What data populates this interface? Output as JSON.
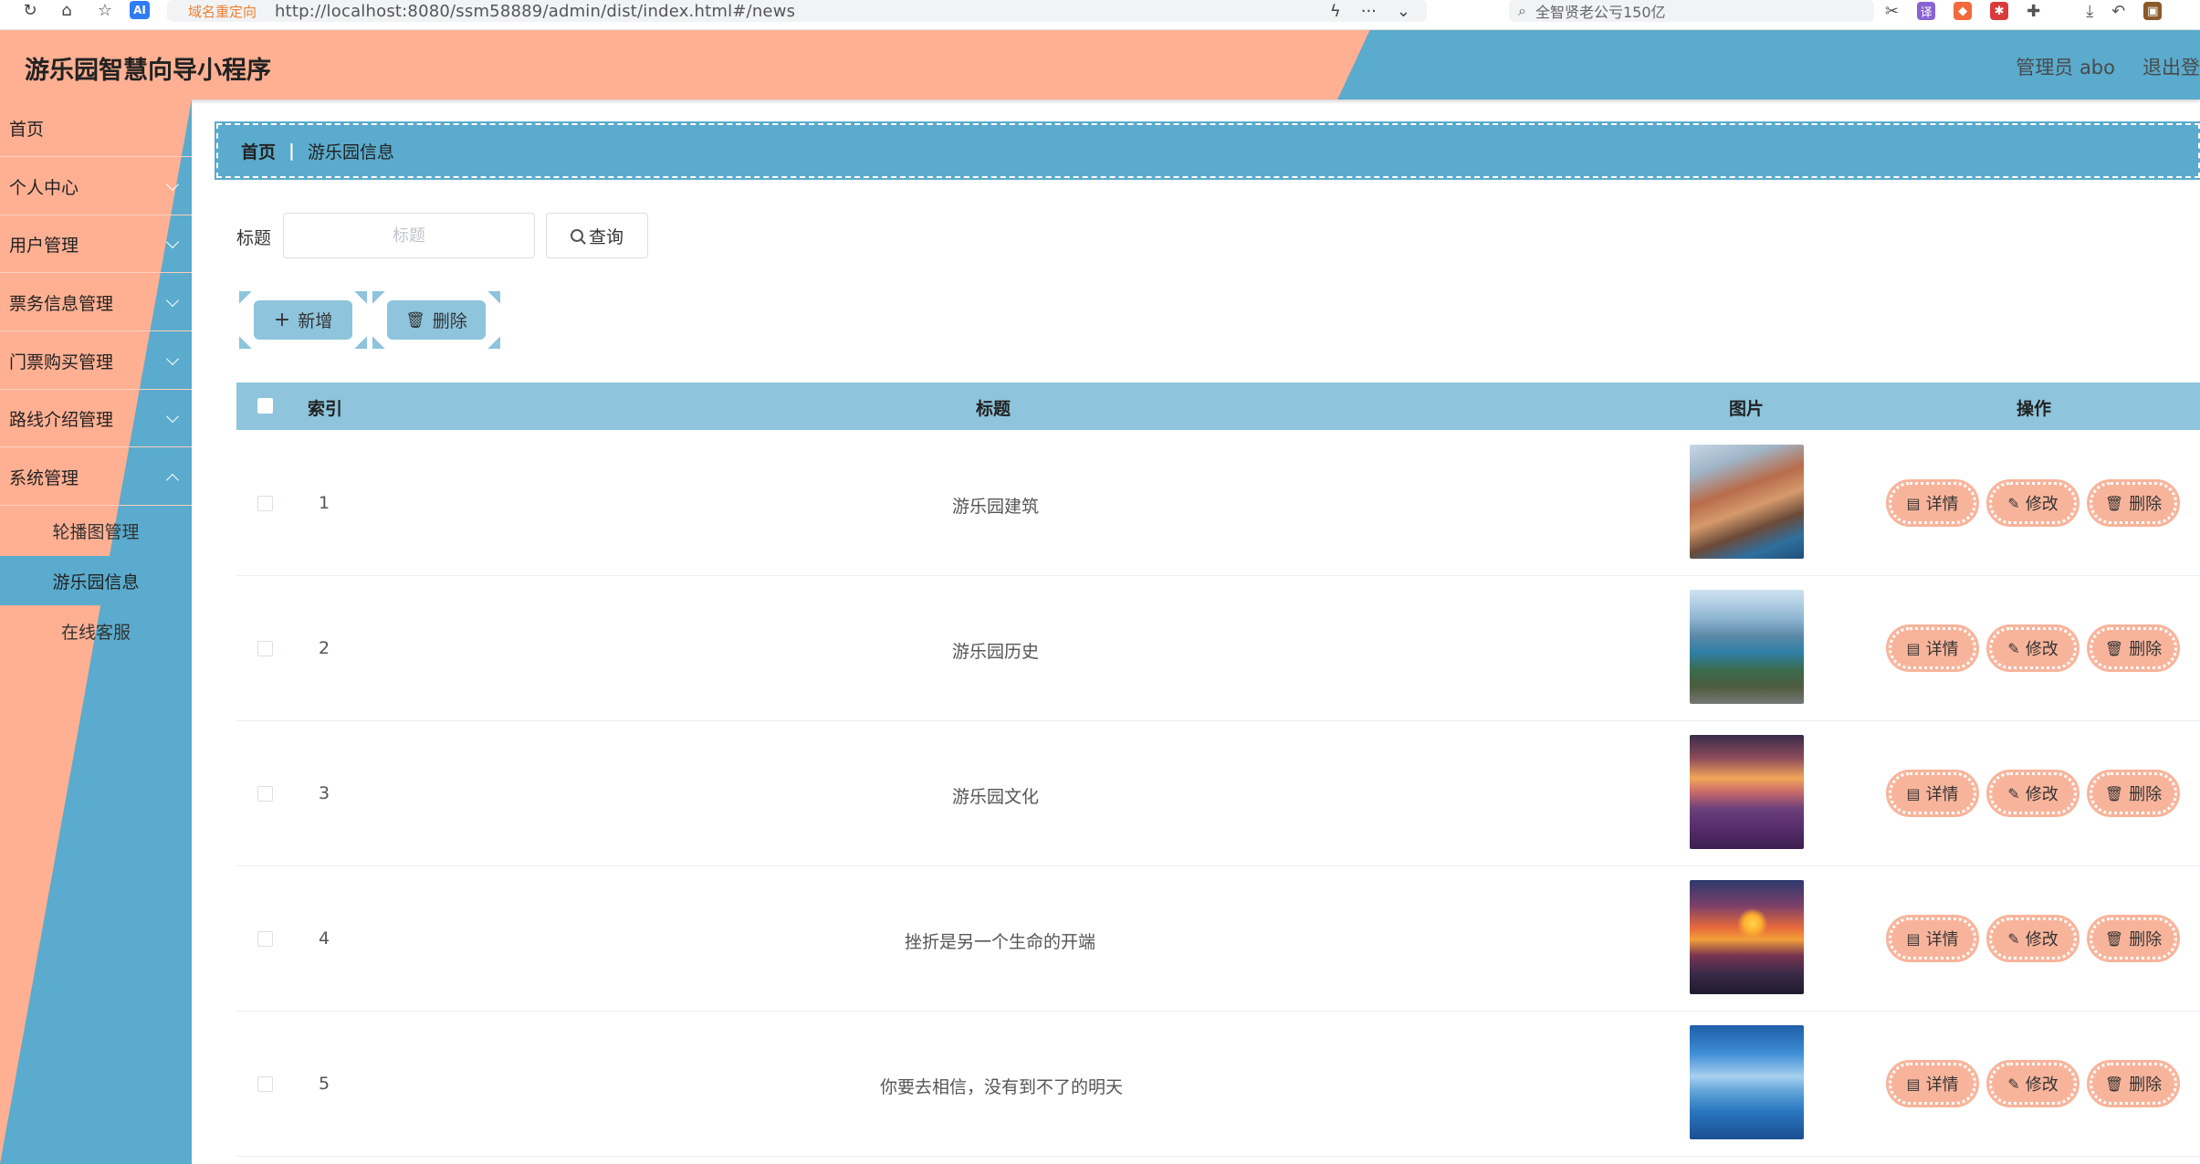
{
  "browser": {
    "url_tag": "域名重定向",
    "url": "http://localhost:8080/ssm58889/admin/dist/index.html#/news",
    "search_text": "全智贤老公亏150亿",
    "ai_label": "AI"
  },
  "header": {
    "title": "游乐园智慧向导小程序",
    "user": "管理员 abo",
    "logout": "退出登"
  },
  "sidebar": {
    "items": [
      {
        "label": "首页"
      },
      {
        "label": "个人中心"
      },
      {
        "label": "用户管理"
      },
      {
        "label": "票务信息管理"
      },
      {
        "label": "门票购买管理"
      },
      {
        "label": "路线介绍管理"
      },
      {
        "label": "系统管理"
      }
    ],
    "sub_items": [
      {
        "label": "轮播图管理"
      },
      {
        "label": "游乐园信息"
      },
      {
        "label": "在线客服"
      }
    ]
  },
  "breadcrumb": {
    "home": "首页",
    "separator": "|",
    "current": "游乐园信息"
  },
  "search": {
    "label": "标题",
    "placeholder": "标题",
    "button": "查询"
  },
  "actions": {
    "add": "新增",
    "delete": "删除"
  },
  "table": {
    "columns": {
      "index": "索引",
      "title": "标题",
      "image": "图片",
      "ops": "操作"
    },
    "rows": [
      {
        "index": "1",
        "title": "游乐园建筑"
      },
      {
        "index": "2",
        "title": "游乐园历史"
      },
      {
        "index": "3",
        "title": "游乐园文化"
      },
      {
        "index": "4",
        "title": "挫折是另一个生命的开端"
      },
      {
        "index": "5",
        "title": "你要去相信，没有到不了的明天"
      }
    ],
    "row_buttons": {
      "detail": "详情",
      "edit": "修改",
      "delete": "删除"
    }
  },
  "colors": {
    "salmon": "#ffb093",
    "blue": "#5aabcd",
    "light_blue": "#8ec4dc",
    "op_button": "#f8b49b"
  }
}
